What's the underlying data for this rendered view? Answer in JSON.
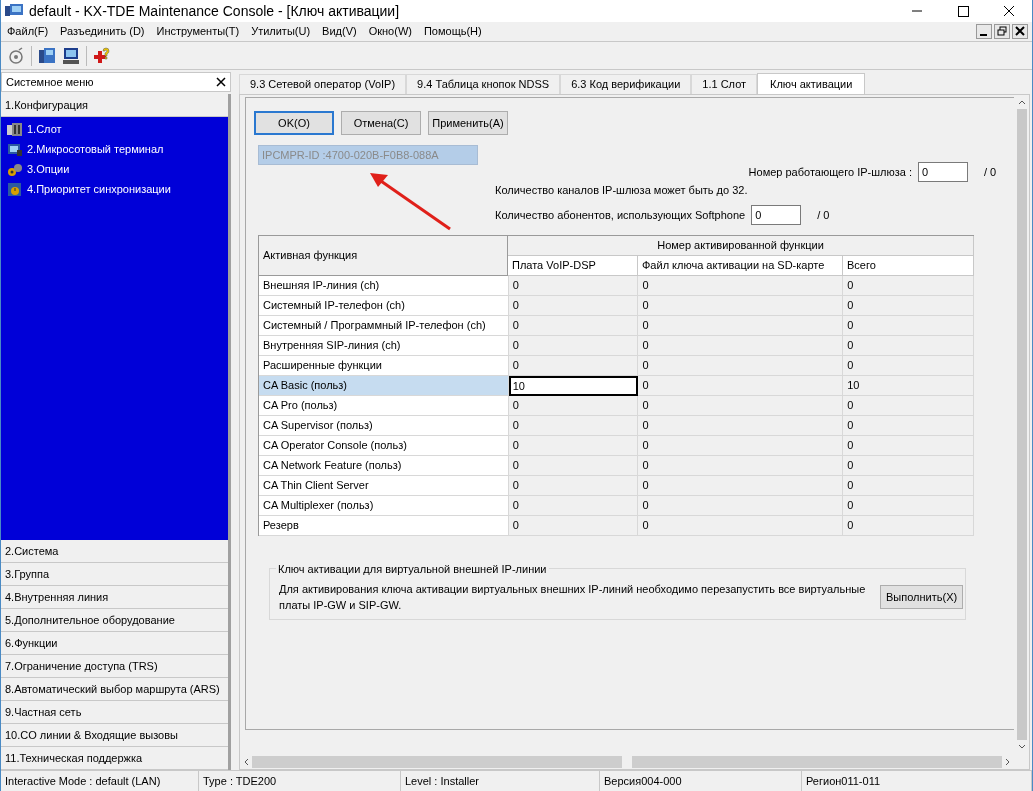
{
  "window": {
    "title": "default - KX-TDE Maintenance Console - [Ключ активации]"
  },
  "menu": [
    "Файл(F)",
    "Разъединить (D)",
    "Инструменты(T)",
    "Утилиты(U)",
    "Вид(V)",
    "Окно(W)",
    "Помощь(H)"
  ],
  "sidebar": {
    "title": "Системное меню",
    "sections": [
      {
        "label": "1.Конфигурация",
        "expanded": true,
        "children": [
          {
            "label": "1.Слот"
          },
          {
            "label": "2.Микросотовый терминал"
          },
          {
            "label": "3.Опции"
          },
          {
            "label": "4.Приоритет синхронизации"
          }
        ]
      },
      {
        "label": "2.Система",
        "expanded": false
      },
      {
        "label": "3.Группа",
        "expanded": false
      },
      {
        "label": "4.Внутренняя линия",
        "expanded": false
      },
      {
        "label": "5.Дополнительное оборудование",
        "expanded": false
      },
      {
        "label": "6.Функции",
        "expanded": false
      },
      {
        "label": "7.Ограничение доступа (TRS)",
        "expanded": false
      },
      {
        "label": "8.Автоматический выбор маршрута (ARS)",
        "expanded": false
      },
      {
        "label": "9.Частная сеть",
        "expanded": false
      },
      {
        "label": "10.CO линии & Входящие вызовы",
        "expanded": false
      },
      {
        "label": "11.Техническая поддержка",
        "expanded": false
      }
    ]
  },
  "tabs": [
    {
      "label": "9.3 Сетевой оператор (VoIP)",
      "selected": false
    },
    {
      "label": "9.4 Таблица кнопок NDSS",
      "selected": false
    },
    {
      "label": "6.3 Код верификации",
      "selected": false
    },
    {
      "label": "1.1 Слот",
      "selected": false
    },
    {
      "label": "Ключ активации",
      "selected": true
    }
  ],
  "buttons": [
    {
      "label": "OK(O)",
      "focused": true
    },
    {
      "label": "Отмена(C)",
      "focused": false
    },
    {
      "label": "Применить(A)",
      "focused": false
    }
  ],
  "id_field": {
    "value": "IPCMPR-ID :4700-020B-F0B8-088A",
    "disabled": true
  },
  "gateway": {
    "label": "Номер работающего IP-шлюза :",
    "value": "0",
    "total": "/ 0",
    "note": "Количество каналов IP-шлюза может быть до 32."
  },
  "softphone": {
    "label": "Количество абонентов, использующих Softphone",
    "value": "0",
    "total": "/ 0"
  },
  "table": {
    "group_header": "Номер активированной функции",
    "columns": [
      "Активная функция",
      "Плата VoIP-DSP",
      "Файл ключа активации на SD-карте",
      "Всего"
    ],
    "rows": [
      {
        "cells": [
          "Внешняя IP-линия (ch)",
          "0",
          "0",
          "0"
        ],
        "selected": false
      },
      {
        "cells": [
          "Системный IP-телефон (ch)",
          "0",
          "0",
          "0"
        ],
        "selected": false
      },
      {
        "cells": [
          "Системный / Программный IP-телефон (ch)",
          "0",
          "0",
          "0"
        ],
        "selected": false
      },
      {
        "cells": [
          "Внутренняя SIP-линия (ch)",
          "0",
          "0",
          "0"
        ],
        "selected": false
      },
      {
        "cells": [
          "Расширенные функции",
          "0",
          "0",
          "0"
        ],
        "selected": false
      },
      {
        "cells": [
          "CA Basic (польз)",
          "10",
          "0",
          "10"
        ],
        "selected": true
      },
      {
        "cells": [
          "CA Pro (польз)",
          "0",
          "0",
          "0"
        ],
        "selected": false
      },
      {
        "cells": [
          "CA Supervisor (польз)",
          "0",
          "0",
          "0"
        ],
        "selected": false
      },
      {
        "cells": [
          "CA Operator Console (польз)",
          "0",
          "0",
          "0"
        ],
        "selected": false
      },
      {
        "cells": [
          "CA Network Feature (польз)",
          "0",
          "0",
          "0"
        ],
        "selected": false
      },
      {
        "cells": [
          "CA Thin Client Server",
          "0",
          "0",
          "0"
        ],
        "selected": false
      },
      {
        "cells": [
          "CA Multiplexer (польз)",
          "0",
          "0",
          "0"
        ],
        "selected": false
      },
      {
        "cells": [
          "Резерв",
          "0",
          "0",
          "0"
        ],
        "selected": false
      }
    ]
  },
  "virtual_key": {
    "title": "Ключ активации для виртуальной внешней IP-линии",
    "text": "Для активирования ключа активации виртуальных внешних IP-линий необходимо перезапустить все виртуальные платы IP-GW и SIP-GW.",
    "button": "Выполнить(X)"
  },
  "status_bar": [
    "Interactive Mode : default (LAN)",
    "Type : TDE200",
    "Level : Installer",
    "Версия004-000",
    "Регион011-011"
  ]
}
